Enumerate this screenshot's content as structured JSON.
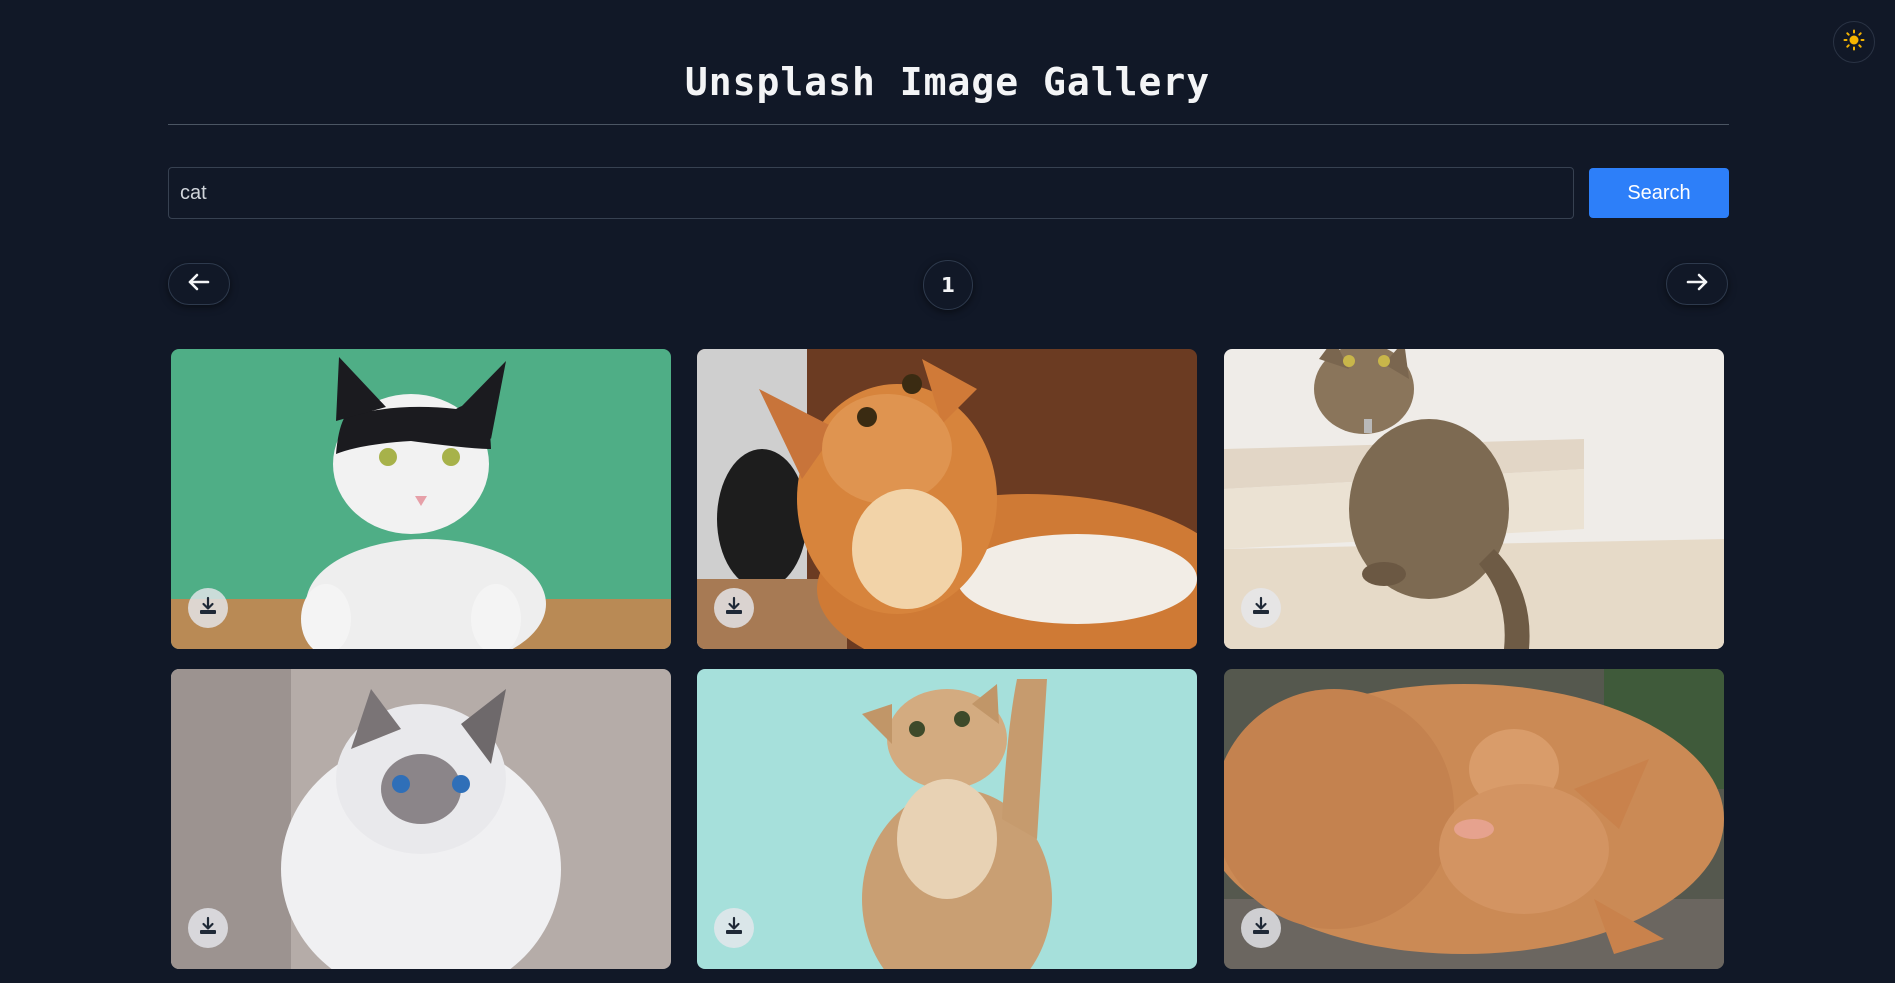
{
  "header": {
    "title": "Unsplash Image Gallery",
    "theme_toggle_icon": "sun-icon"
  },
  "search": {
    "value": "cat",
    "button_label": "Search"
  },
  "pagination": {
    "current_page": "1",
    "prev_icon": "arrow-left-icon",
    "next_icon": "arrow-right-icon"
  },
  "gallery": {
    "images": [
      {
        "subject": "black and white cat on green background",
        "action_icon": "download-icon"
      },
      {
        "subject": "orange tabby cat looking up",
        "action_icon": "download-icon"
      },
      {
        "subject": "brown tabby cat sitting on stairs",
        "action_icon": "download-icon"
      },
      {
        "subject": "siamese cat with blue eyes",
        "action_icon": "download-icon"
      },
      {
        "subject": "kitten reaching up on teal background",
        "action_icon": "download-icon"
      },
      {
        "subject": "orange cat sleeping on its back",
        "action_icon": "download-icon"
      }
    ]
  },
  "colors": {
    "background": "#111827",
    "accent": "#2d7ff9",
    "text": "#f3f4f6",
    "sun": "#f5b400"
  }
}
